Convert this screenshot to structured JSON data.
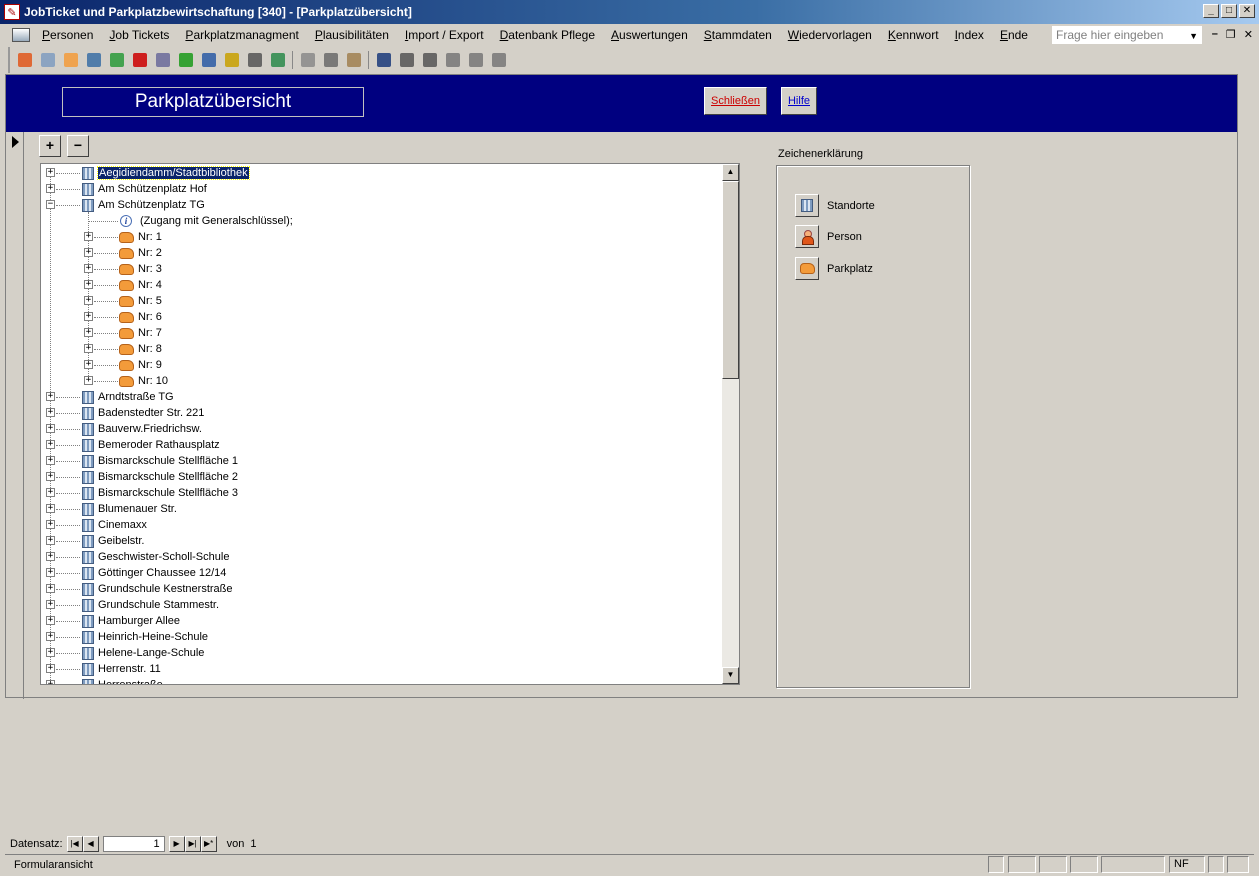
{
  "window": {
    "title": "JobTicket und Parkplatzbewirtschaftung [340] - [Parkplatzübersicht]",
    "icon": "app-icon"
  },
  "menu": {
    "items": [
      "Personen",
      "Job Tickets",
      "Parkplatzmanagment",
      "Plausibilitäten",
      "Import / Export",
      "Datenbank Pflege",
      "Auswertungen",
      "Stammdaten",
      "Wiedervorlagen",
      "Kennwort",
      "Index",
      "Ende"
    ],
    "ask_placeholder": "Frage hier eingeben"
  },
  "toolbar": {
    "icons": [
      "person-icon",
      "form-icon",
      "car-icon",
      "check-icon",
      "recycle-icon",
      "medical-icon",
      "report-icon",
      "refresh-icon",
      "book-icon",
      "key-icon",
      "settings-icon",
      "import-icon",
      "copy-icon",
      "cut-icon",
      "paste-icon",
      "find-icon",
      "sort-asc-icon",
      "sort-desc-icon",
      "filter-icon",
      "filter-form-icon",
      "filter-apply-icon"
    ]
  },
  "form": {
    "title": "Parkplatzübersicht",
    "close_label": "Schließen",
    "help_label": "Hilfe",
    "expand_label": "+",
    "collapse_label": "−"
  },
  "tree": {
    "top": [
      {
        "label": "Aegidiendamm/Stadtbibliothek",
        "selected": true
      },
      {
        "label": "Am Schützenplatz Hof"
      },
      {
        "label": "Am Schützenplatz TG",
        "expanded": true,
        "info": "(Zugang mit Generalschlüssel);",
        "children": [
          "Nr: 1",
          "Nr: 2",
          "Nr: 3",
          "Nr: 4",
          "Nr: 5",
          "Nr: 6",
          "Nr: 7",
          "Nr: 8",
          "Nr: 9",
          "Nr: 10"
        ]
      },
      {
        "label": "Arndtstraße TG"
      },
      {
        "label": "Badenstedter Str. 221"
      },
      {
        "label": "Bauverw.Friedrichsw."
      },
      {
        "label": "Bemeroder Rathausplatz"
      },
      {
        "label": "Bismarckschule Stellfläche 1"
      },
      {
        "label": "Bismarckschule Stellfläche 2"
      },
      {
        "label": "Bismarckschule Stellfläche 3"
      },
      {
        "label": "Blumenauer Str."
      },
      {
        "label": "Cinemaxx"
      },
      {
        "label": "Geibelstr."
      },
      {
        "label": "Geschwister-Scholl-Schule"
      },
      {
        "label": "Göttinger Chaussee 12/14"
      },
      {
        "label": "Grundschule Kestnerstraße"
      },
      {
        "label": "Grundschule Stammestr."
      },
      {
        "label": "Hamburger Allee"
      },
      {
        "label": "Heinrich-Heine-Schule"
      },
      {
        "label": "Helene-Lange-Schule"
      },
      {
        "label": "Herrenstr. 11"
      },
      {
        "label": "Herrenstraße"
      }
    ]
  },
  "legend": {
    "caption": "Zeichenerklärung",
    "items": [
      {
        "label": "Standorte",
        "icon": "building-icon"
      },
      {
        "label": "Person",
        "icon": "person-icon"
      },
      {
        "label": "Parkplatz",
        "icon": "car-icon"
      }
    ]
  },
  "nav": {
    "label": "Datensatz:",
    "current": "1",
    "of_label": "von",
    "total": "1"
  },
  "status": {
    "view": "Formularansicht",
    "mode": "NF"
  }
}
